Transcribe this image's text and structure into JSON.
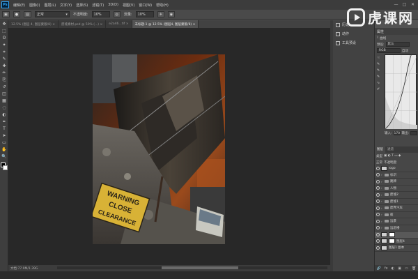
{
  "app": {
    "logo": "Ps",
    "menus": [
      "编辑(E)",
      "图像(I)",
      "图层(L)",
      "文字(Y)",
      "选择(S)",
      "滤镜(T)",
      "3D(D)",
      "视图(V)",
      "窗口(W)",
      "帮助(H)"
    ],
    "window_controls": [
      "—",
      "□",
      "✕"
    ]
  },
  "watermark": {
    "text": "虎课网"
  },
  "options_bar": {
    "select_value": "正常",
    "opacity_label": "不透明度:",
    "opacity_value": "10%",
    "flow_label": "流量:",
    "flow_value": "10%"
  },
  "tools": [
    "move-icon",
    "marquee-icon",
    "lasso-icon",
    "magic-wand-icon",
    "crop-icon",
    "eyedropper-icon",
    "healing-icon",
    "brush-icon",
    "stamp-icon",
    "history-brush-icon",
    "eraser-icon",
    "gradient-icon",
    "blur-icon",
    "dodge-icon",
    "pen-icon",
    "type-icon",
    "path-select-icon",
    "shape-icon",
    "hand-icon",
    "zoom-icon"
  ],
  "tabs": [
    {
      "label": "12.5% (图层 4, 图层蒙版/8) ×"
    },
    {
      "label": "废墟素材.psd @ 50% (...) ×"
    },
    {
      "label": "e2a46...tif ×"
    },
    {
      "label": "未标题-1 @ 12.5% (图层4, 图层蒙版/8) ×",
      "active": true
    }
  ],
  "status": {
    "text": "文档:77.9M/1.39G"
  },
  "panel_list": [
    {
      "icon": "history-icon",
      "label": "历史"
    },
    {
      "icon": "actions-icon",
      "label": "动作"
    },
    {
      "icon": "tool-presets-icon",
      "label": "工具预设"
    }
  ],
  "properties": {
    "title": "属性",
    "subtitle": "曲线",
    "preset_label": "预设:",
    "preset_value": "默认",
    "channel_value": "RGB",
    "auto_label": "自动",
    "input_label": "输入:",
    "input_value": "170",
    "output_label": "输出:"
  },
  "layers_panel": {
    "tabs": [
      "图层",
      "通道"
    ],
    "filter_label": "类型",
    "blend_mode": "正常",
    "opacity_label": "不透明度:",
    "rows": [
      {
        "name": "logo",
        "type": "layer"
      },
      {
        "name": "标识",
        "type": "folder"
      },
      {
        "name": "路牌",
        "type": "folder"
      },
      {
        "name": "人物",
        "type": "folder"
      },
      {
        "name": "废墟2",
        "type": "folder"
      },
      {
        "name": "废墟1",
        "type": "folder"
      },
      {
        "name": "废弃汽车",
        "type": "folder"
      },
      {
        "name": "船",
        "type": "folder"
      },
      {
        "name": "远景",
        "type": "folder"
      },
      {
        "name": "远近楼",
        "type": "folder"
      },
      {
        "name": "",
        "type": "adjust",
        "selected": true
      },
      {
        "name": "图层4",
        "type": "mask"
      },
      {
        "name": "图层1 副本",
        "type": "layer"
      }
    ],
    "footer": [
      "🔗",
      "fx",
      "◐",
      "▣",
      "▭",
      "🗑"
    ]
  },
  "canvas": {
    "sign_text": [
      "WARNING",
      "CLOSE",
      "CLEARANCE"
    ]
  },
  "colors": {
    "accent": "#31a8ff",
    "sky": "#8a3a14",
    "canvas_bg": "#282828"
  }
}
